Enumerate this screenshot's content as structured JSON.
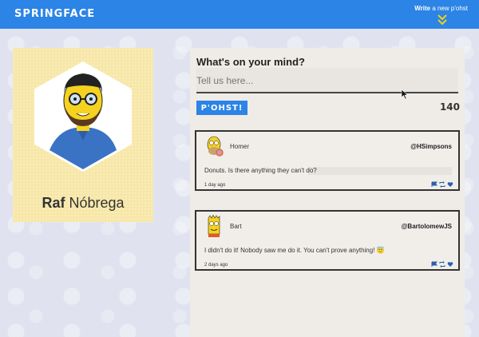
{
  "header": {
    "logo": "SPRINGFACE",
    "write_new_bold": "Write",
    "write_new_rest": " a new p'ohst",
    "chevron_icon": "double-chevron-down-icon"
  },
  "profile": {
    "first_name": "Raf",
    "last_name": "Nóbrega",
    "avatar_icon": "simpson-avatar-icon"
  },
  "composer": {
    "question": "What's on your mind?",
    "placeholder": "Tell us here...",
    "post_button": "P'OHST!",
    "char_count": "140"
  },
  "feed": [
    {
      "name": "Homer",
      "handle": "@HSimpsons",
      "text": "Donuts. Is there anything they can't do?",
      "date": "1 day ago"
    },
    {
      "name": "Bart",
      "handle": "@BartolomewJS",
      "text": "I didn't do it! Nobody saw me do it. You can't prove anything! 😇",
      "date": "2 days ago"
    }
  ],
  "colors": {
    "brand": "#2b84e6",
    "profile_bg": "#f7e7a7",
    "panel_bg": "#efebe6"
  }
}
